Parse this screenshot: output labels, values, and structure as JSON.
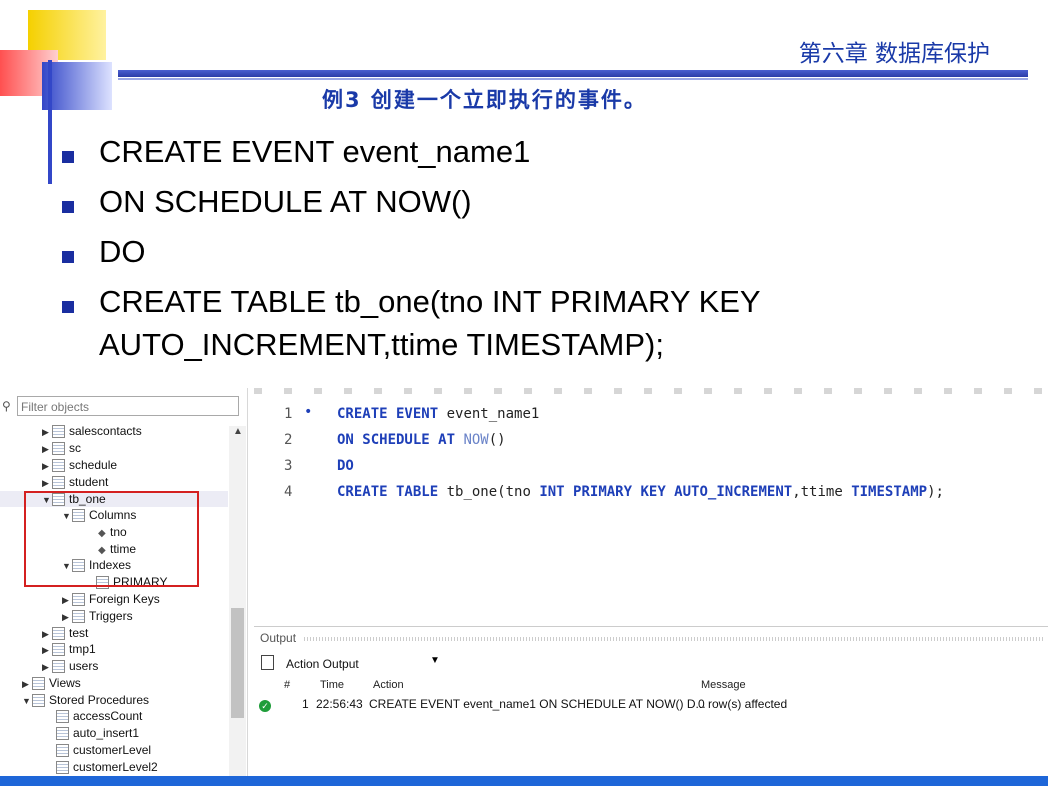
{
  "slide": {
    "chapter_title": "第六章 数据库保护",
    "example_heading": "例3 创建一个立即执行的事件。",
    "bullets": [
      "CREATE EVENT event_name1",
      "ON SCHEDULE AT NOW()",
      "DO",
      "CREATE TABLE tb_one(tno INT PRIMARY KEY",
      "AUTO_INCREMENT,ttime TIMESTAMP);"
    ]
  },
  "navigator": {
    "filter_placeholder": "Filter objects",
    "tree": {
      "salescontacts": "salescontacts",
      "sc": "sc",
      "schedule": "schedule",
      "student": "student",
      "tb_one": "tb_one",
      "columns": "Columns",
      "col_tno": "tno",
      "col_ttime": "ttime",
      "indexes": "Indexes",
      "primary": "PRIMARY",
      "foreign_keys": "Foreign Keys",
      "triggers": "Triggers",
      "test": "test",
      "tmp1": "tmp1",
      "users": "users",
      "views": "Views",
      "stored_procedures": "Stored Procedures",
      "access_count": "accessCount",
      "auto_insert1": "auto_insert1",
      "customer_level": "customerLevel",
      "customer_level2": "customerLevel2"
    }
  },
  "editor": {
    "line_numbers": [
      "1",
      "2",
      "3",
      "4"
    ],
    "line1": {
      "kw": "CREATE EVENT",
      "rest": " event_name1"
    },
    "line2": {
      "kw": "ON SCHEDULE AT",
      "fn": " NOW",
      "rest": "()"
    },
    "line3": {
      "kw": "DO"
    },
    "line4": {
      "kw1": "CREATE TABLE",
      "t1": " tb_one(tno ",
      "kw2": "INT PRIMARY KEY AUTO_INCREMENT",
      "t2": ",ttime ",
      "kw3": "TIMESTAMP",
      "t3": ");"
    }
  },
  "output": {
    "label": "Output",
    "selector": "Action Output",
    "headers": {
      "num": "#",
      "time": "Time",
      "action": "Action",
      "message": "Message"
    },
    "row": {
      "num": "1",
      "time": "22:56:43",
      "action": "CREATE EVENT event_name1 ON SCHEDULE AT NOW() D...",
      "message": "0 row(s) affected"
    }
  },
  "colors": {
    "title_blue": "#1a3aa8",
    "keyword_blue": "#1e3fb8",
    "highlight_red": "#d42020",
    "success_green": "#1f9d3a"
  }
}
